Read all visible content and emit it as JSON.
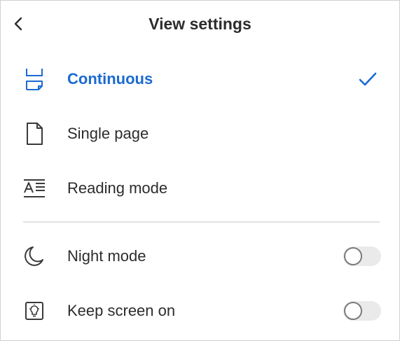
{
  "header": {
    "title": "View settings",
    "back_icon": "chevron-left-icon"
  },
  "accent_color": "#1b6ad0",
  "view_modes": [
    {
      "label": "Continuous",
      "icon": "continuous-scroll-icon",
      "selected": true
    },
    {
      "label": "Single page",
      "icon": "single-page-icon",
      "selected": false
    },
    {
      "label": "Reading mode",
      "icon": "reading-mode-icon",
      "selected": false
    }
  ],
  "toggles": [
    {
      "label": "Night mode",
      "icon": "moon-icon",
      "on": false
    },
    {
      "label": "Keep screen on",
      "icon": "lightbulb-icon",
      "on": false
    }
  ]
}
